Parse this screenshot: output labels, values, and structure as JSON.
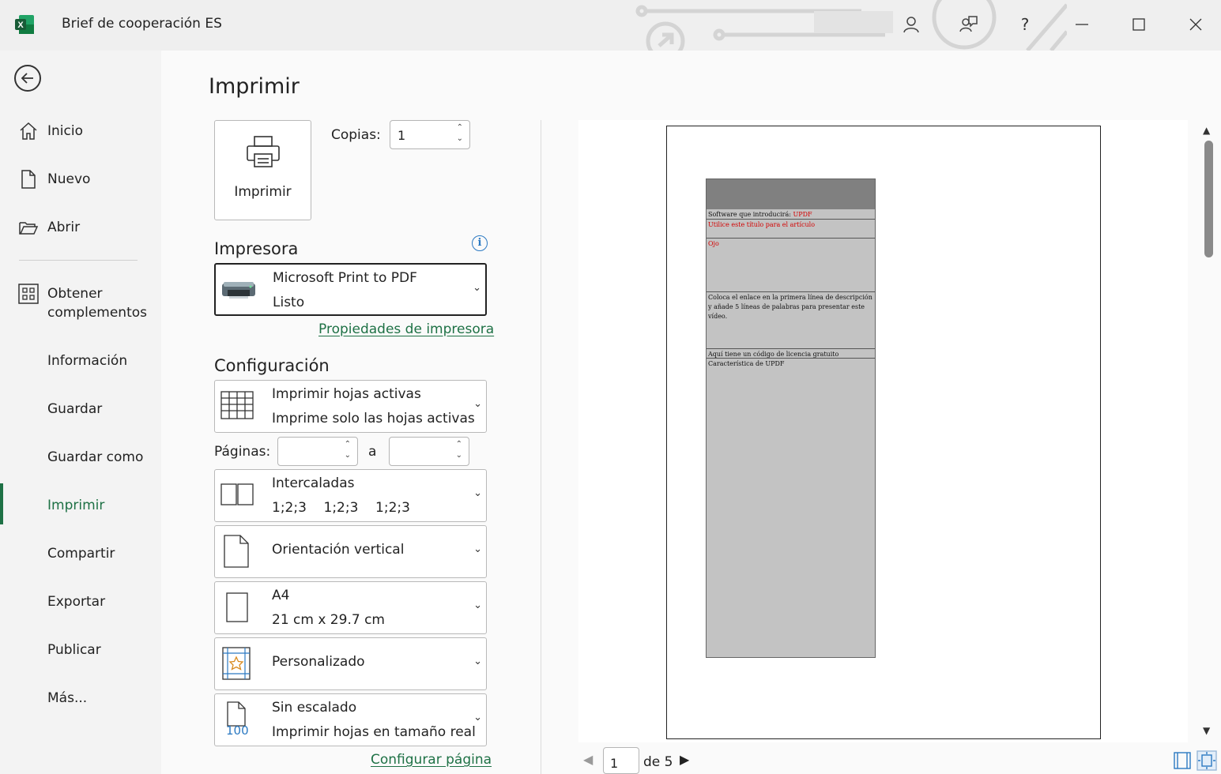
{
  "window": {
    "title": "Brief de cooperación ES",
    "help_label": "?"
  },
  "nav": {
    "items": [
      {
        "label": "Inicio",
        "icon": "home-icon"
      },
      {
        "label": "Nuevo",
        "icon": "new-document-icon"
      },
      {
        "label": "Abrir",
        "icon": "open-folder-icon"
      },
      {
        "label": "Obtener",
        "label2": "complementos",
        "icon": "addins-grid-icon"
      },
      {
        "label": "Información"
      },
      {
        "label": "Guardar"
      },
      {
        "label": "Guardar como"
      },
      {
        "label": "Imprimir",
        "active": true
      },
      {
        "label": "Compartir"
      },
      {
        "label": "Exportar"
      },
      {
        "label": "Publicar"
      },
      {
        "label": "Más..."
      }
    ]
  },
  "print": {
    "title": "Imprimir",
    "print_button_label": "Imprimir",
    "copies_label": "Copias:",
    "copies_value": "1",
    "printer_section": "Impresora",
    "printer_name": "Microsoft Print to PDF",
    "printer_status": "Listo",
    "printer_properties_link": "Propiedades de impresora",
    "settings_section": "Configuración",
    "what_to_print": {
      "title": "Imprimir hojas activas",
      "subtitle": "Imprime solo las hojas activas"
    },
    "pages_label": "Páginas:",
    "pages_to_label": "a",
    "collation": {
      "title": "Intercaladas",
      "subtitle": "1;2;3    1;2;3    1;2;3"
    },
    "orientation": {
      "title": "Orientación vertical"
    },
    "paper_size": {
      "title": "A4",
      "subtitle": "21 cm x 29.7 cm"
    },
    "margins": {
      "title": "Personalizado"
    },
    "scaling": {
      "title": "Sin escalado",
      "subtitle": "Imprimir hojas en tamaño real",
      "icon_text": "100"
    },
    "page_setup_link": "Configurar página"
  },
  "preview": {
    "rows": [
      {
        "text": "Software que introducirá: ",
        "red_suffix": "UPDF"
      },
      {
        "red_text": "Utilice este título para el artículo"
      },
      {
        "red_text": "Ojo"
      },
      {
        "text": "Coloca el enlace en la primera línea de descripción y añade 5 líneas de palabras para presentar este vídeo."
      },
      {
        "text": "Aquí tiene un código de licencia gratuito"
      },
      {
        "text": "Característica de UPDF"
      }
    ],
    "current_page": "1",
    "of_label": "de 5"
  },
  "colors": {
    "accent": "#1e7145",
    "link": "#1e7145",
    "info": "#2b79c2",
    "sheet_fill": "#c3c3c3",
    "sheet_header": "#808080",
    "red_text": "#d40000"
  }
}
